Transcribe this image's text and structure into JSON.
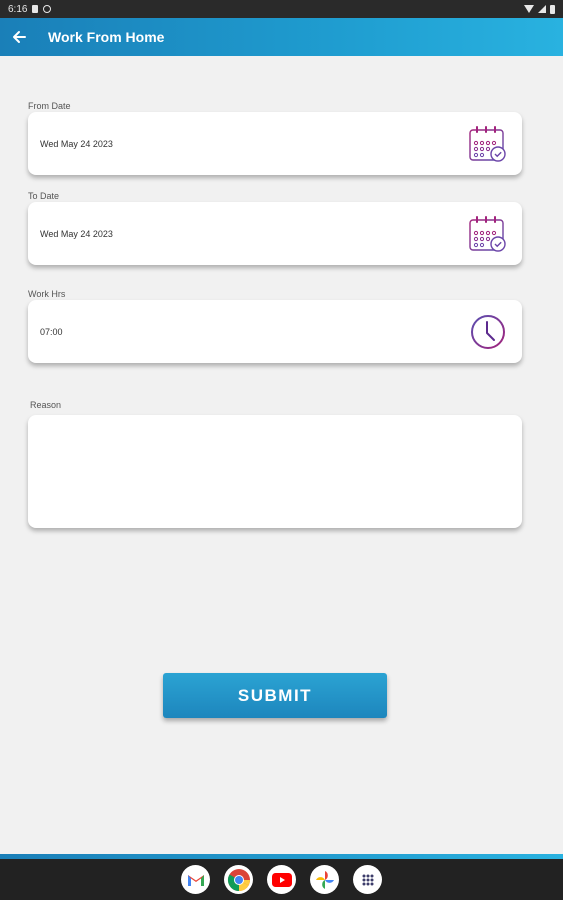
{
  "status_bar": {
    "time": "6:16"
  },
  "app_bar": {
    "title": "Work From Home"
  },
  "form": {
    "from_date": {
      "label": "From Date",
      "value": "Wed May 24 2023"
    },
    "to_date": {
      "label": "To Date",
      "value": "Wed May 24 2023"
    },
    "work_hrs": {
      "label": "Work Hrs",
      "value": "07:00"
    },
    "reason": {
      "label": "Reason",
      "value": ""
    }
  },
  "submit": {
    "label": "SUBMIT"
  },
  "colors": {
    "primary": "#1d8fc6",
    "accent_icon": "#a2237c",
    "background": "#f1f1f1"
  },
  "icons": {
    "back": "arrow-left-icon",
    "from_date": "calendar-check-icon",
    "to_date": "calendar-check-icon",
    "work_hrs": "clock-icon"
  },
  "dock": [
    "gmail-icon",
    "chrome-icon",
    "youtube-icon",
    "photos-icon",
    "app-drawer-icon"
  ]
}
